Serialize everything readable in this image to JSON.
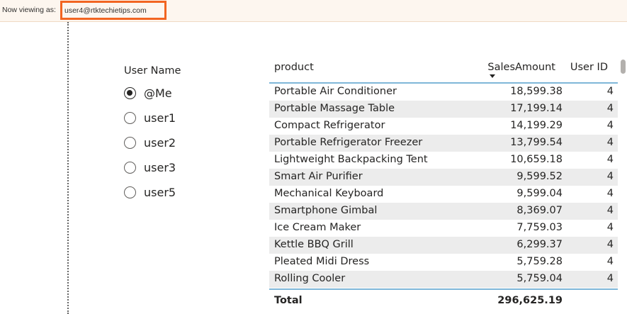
{
  "banner": {
    "viewing_label": "Now viewing as:",
    "user_email": "user4@rtktechietips.com"
  },
  "slicer": {
    "title": "User Name",
    "options": [
      {
        "label": "@Me",
        "selected": true
      },
      {
        "label": "user1",
        "selected": false
      },
      {
        "label": "user2",
        "selected": false
      },
      {
        "label": "user3",
        "selected": false
      },
      {
        "label": "user5",
        "selected": false
      }
    ]
  },
  "table": {
    "headers": {
      "product": "product",
      "sales": "SalesAmount",
      "user_id": "User ID"
    },
    "sort_column": "SalesAmount",
    "sort_direction": "descending",
    "rows": [
      {
        "product": "Portable Air Conditioner",
        "sales": "18,599.38",
        "user_id": "4"
      },
      {
        "product": "Portable Massage Table",
        "sales": "17,199.14",
        "user_id": "4"
      },
      {
        "product": "Compact Refrigerator",
        "sales": "14,199.29",
        "user_id": "4"
      },
      {
        "product": "Portable Refrigerator Freezer",
        "sales": "13,799.54",
        "user_id": "4"
      },
      {
        "product": "Lightweight Backpacking Tent",
        "sales": "10,659.18",
        "user_id": "4"
      },
      {
        "product": "Smart Air Purifier",
        "sales": "9,599.52",
        "user_id": "4"
      },
      {
        "product": "Mechanical Keyboard",
        "sales": "9,599.04",
        "user_id": "4"
      },
      {
        "product": "Smartphone Gimbal",
        "sales": "8,369.07",
        "user_id": "4"
      },
      {
        "product": "Ice Cream Maker",
        "sales": "7,759.03",
        "user_id": "4"
      },
      {
        "product": "Kettle BBQ Grill",
        "sales": "6,299.37",
        "user_id": "4"
      },
      {
        "product": "Pleated Midi Dress",
        "sales": "5,759.28",
        "user_id": "4"
      },
      {
        "product": "Rolling Cooler",
        "sales": "5,759.04",
        "user_id": "4"
      }
    ],
    "total": {
      "label": "Total",
      "sales": "296,625.19"
    }
  },
  "colors": {
    "highlight_border": "#f26522",
    "header_rule": "#7fb7d9",
    "alt_row": "#ececec"
  }
}
